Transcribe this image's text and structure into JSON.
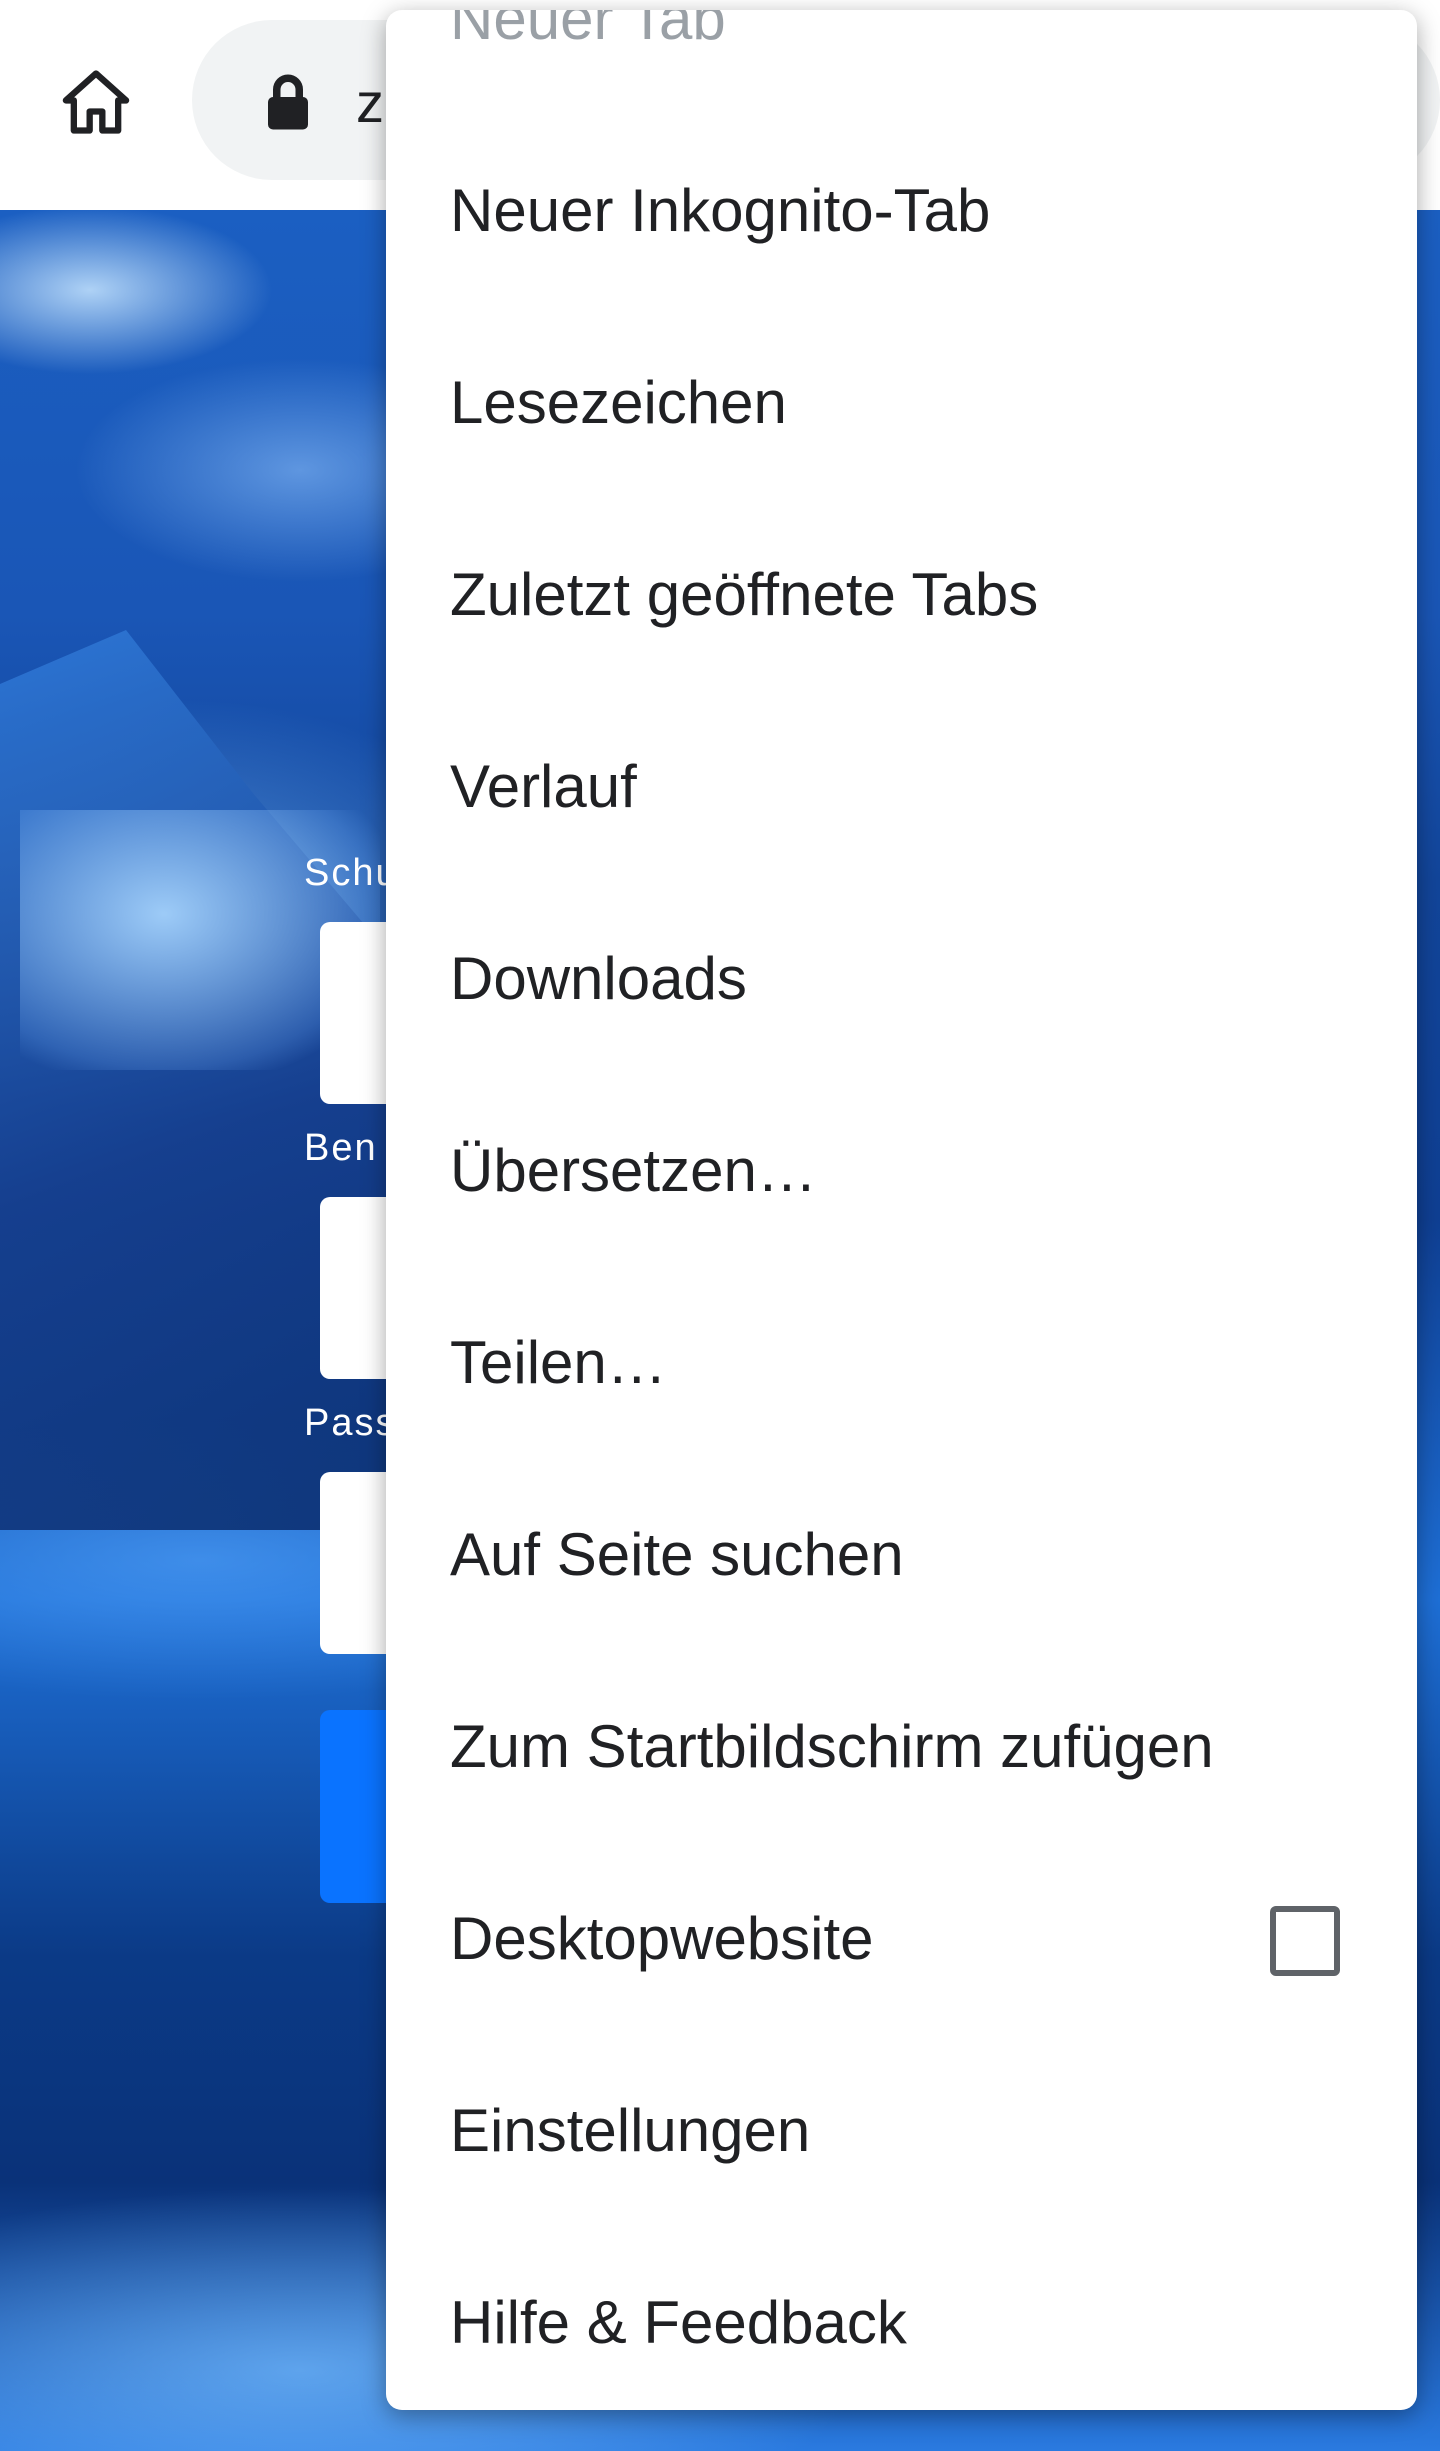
{
  "toolbar": {
    "home_icon": "home-icon",
    "lock_icon": "lock-icon",
    "url_partial": "z"
  },
  "background_form": {
    "labels": [
      "Schu",
      "Ben",
      "Pass"
    ]
  },
  "menu": {
    "items": [
      {
        "label": "Neuer Tab"
      },
      {
        "label": "Neuer Inkognito-Tab"
      },
      {
        "label": "Lesezeichen"
      },
      {
        "label": "Zuletzt geöffnete Tabs"
      },
      {
        "label": "Verlauf"
      },
      {
        "label": "Downloads"
      },
      {
        "label": "Übersetzen…"
      },
      {
        "label": "Teilen…"
      },
      {
        "label": "Auf Seite suchen"
      },
      {
        "label": "Zum Startbildschirm zufügen"
      },
      {
        "label": "Desktopwebsite",
        "checkbox_checked": false
      },
      {
        "label": "Einstellungen"
      },
      {
        "label": "Hilfe & Feedback"
      }
    ]
  },
  "colors": {
    "menu_text": "#202124",
    "menu_background": "#ffffff",
    "login_button": "#0a73ff"
  }
}
